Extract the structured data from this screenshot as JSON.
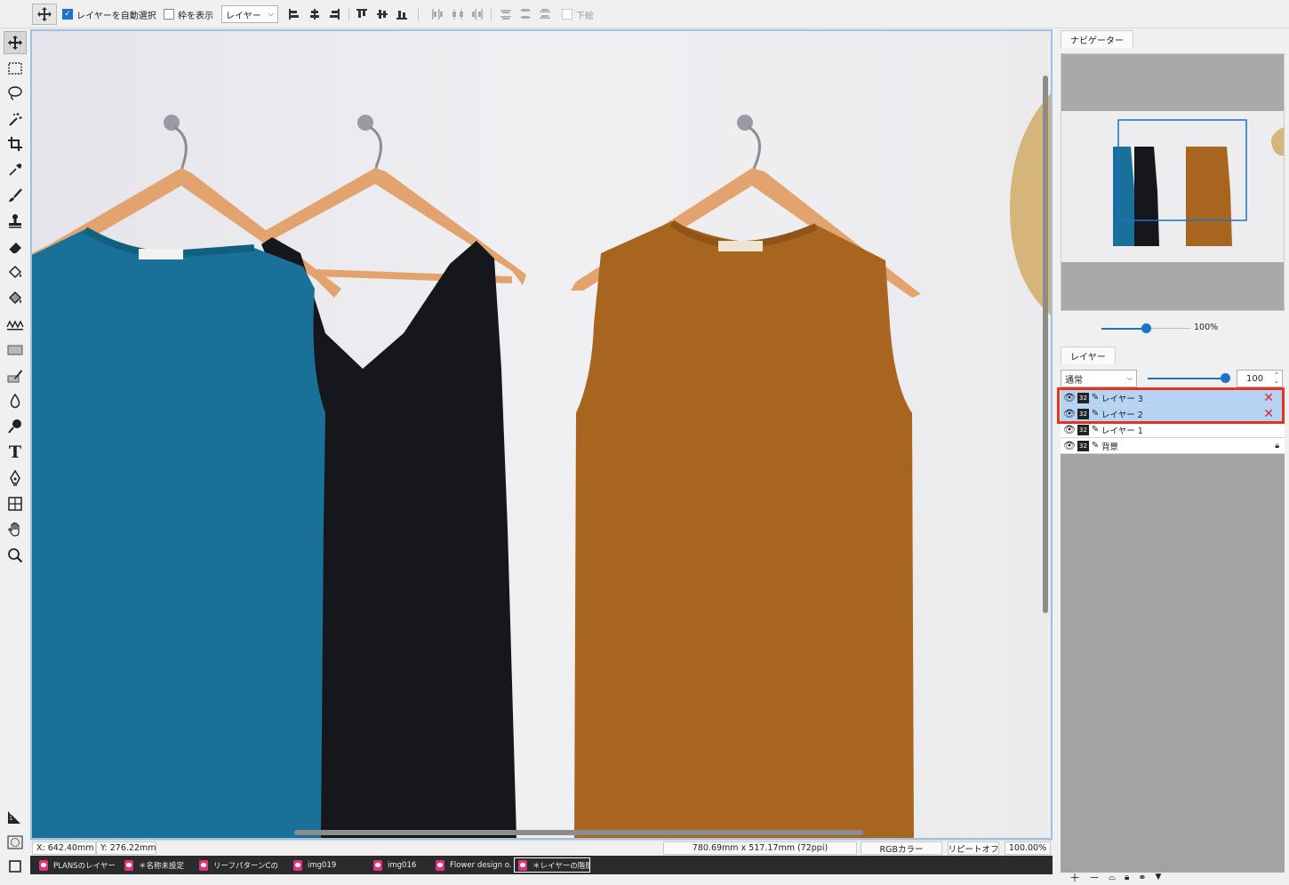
{
  "toolbar": {
    "auto_select_checked": true,
    "auto_select_label": "レイヤーを自動選択",
    "show_bounds_checked": false,
    "show_bounds_label": "枠を表示",
    "target_select_value": "レイヤー",
    "bottom_label": "下絵"
  },
  "tools": [
    "move",
    "rect-select",
    "lasso",
    "magic-wand",
    "crop",
    "eyedropper",
    "brush",
    "stamp",
    "eraser",
    "fill",
    "gradient-fill",
    "smudge",
    "rectangle-shape",
    "pen-shape",
    "blur",
    "dodge",
    "text",
    "pen",
    "transform",
    "hand",
    "zoom",
    "ruler",
    "quick-mask",
    "screen-mode"
  ],
  "status": {
    "x": "X: 642.40mm",
    "y": "Y: 276.22mm",
    "doc_size": "780.69mm x 517.17mm (72ppi)",
    "color_mode": "RGBカラー",
    "repeat": "リピートオフ",
    "zoom": "100.00%"
  },
  "doc_tabs": [
    {
      "label": "PLANSのレイヤー",
      "active": false
    },
    {
      "label": "＊名称未設定",
      "active": false
    },
    {
      "label": "リーフパターンCの...",
      "active": false
    },
    {
      "label": "img019",
      "active": false
    },
    {
      "label": "img016",
      "active": false
    },
    {
      "label": "Flower design o...",
      "active": false
    },
    {
      "label": "＊レイヤーの階層...",
      "active": true
    }
  ],
  "navigator": {
    "tab_label": "ナビゲーター",
    "zoom_label": "100%",
    "zoom_fraction": 0.5
  },
  "layers": {
    "tab_label": "レイヤー",
    "blend_mode": "通常",
    "opacity": "100",
    "opacity_fraction": 1.0,
    "items": [
      {
        "name": "レイヤー 3",
        "bit": "32",
        "selected": true,
        "delete_mark": true,
        "locked": false
      },
      {
        "name": "レイヤー 2",
        "bit": "32",
        "selected": true,
        "delete_mark": true,
        "locked": false
      },
      {
        "name": "レイヤー 1",
        "bit": "32",
        "selected": false,
        "delete_mark": false,
        "locked": false
      },
      {
        "name": "背景",
        "bit": "32",
        "selected": false,
        "delete_mark": false,
        "locked": true
      }
    ],
    "footer_icons": [
      "add-layer-icon",
      "remove-layer-icon",
      "mask-icon",
      "lock-icon",
      "link-icon",
      "menu-triangle-icon"
    ]
  },
  "colors": {
    "accent": "#1a73c9",
    "selection_highlight": "#b5d4f5",
    "annotation_red": "#e8311e",
    "shirt_blue": "#19719a",
    "shirt_black": "#15171c",
    "shirt_brown": "#a8651f"
  }
}
